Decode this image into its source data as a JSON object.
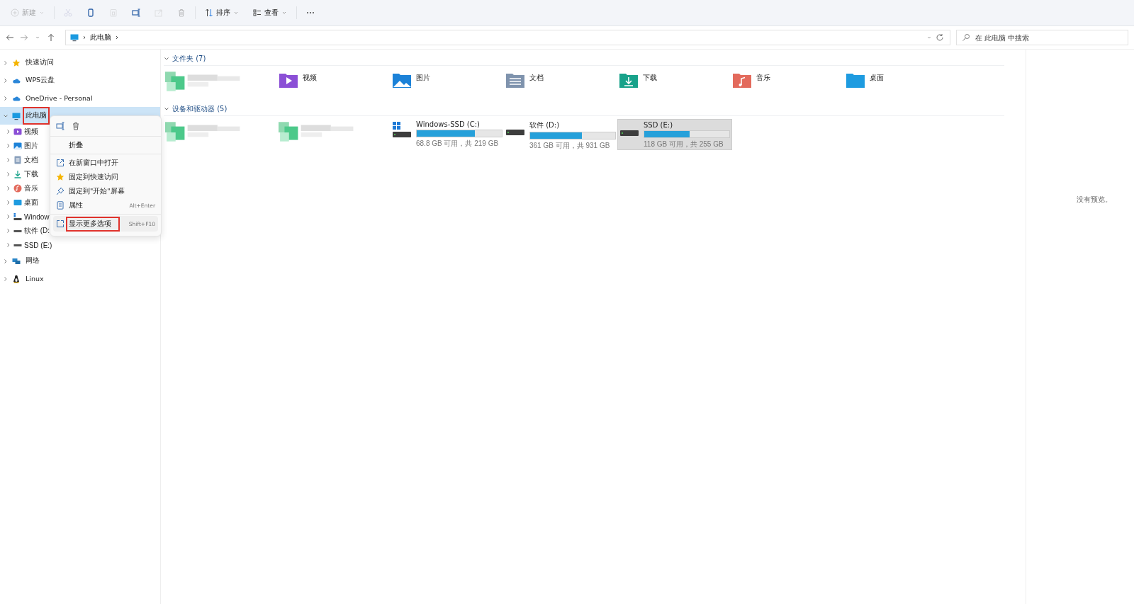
{
  "toolbar": {
    "items": [
      {
        "kind": "new",
        "label": "新建",
        "disabled": true
      },
      {
        "kind": "cut",
        "disabled": true
      },
      {
        "kind": "copy",
        "disabled": false
      },
      {
        "kind": "paste",
        "disabled": true
      },
      {
        "kind": "rename",
        "disabled": false
      },
      {
        "kind": "share",
        "disabled": true
      },
      {
        "kind": "delete",
        "disabled": true
      },
      {
        "kind": "sort",
        "label": "排序",
        "disabled": false
      },
      {
        "kind": "view",
        "label": "查看",
        "disabled": false
      },
      {
        "kind": "more",
        "disabled": false
      }
    ]
  },
  "address_bar": {
    "path": [
      "此电脑"
    ],
    "search": {
      "placeholder": "在 此电脑 中搜索"
    }
  },
  "sidebar": {
    "items": [
      {
        "kind": "star",
        "label": "快速访问",
        "expanded": false,
        "selected": false,
        "annotated": false
      },
      {
        "kind": "cloud",
        "label": "WPS云盘",
        "expanded": false,
        "selected": false,
        "annotated": false
      },
      {
        "kind": "cloud",
        "label": "OneDrive - Personal",
        "expanded": false,
        "selected": false,
        "annotated": false
      },
      {
        "kind": "pc",
        "label": "此电脑",
        "expanded": true,
        "selected": true,
        "annotated": true,
        "children": [
          {
            "kind": "video",
            "label": "视频"
          },
          {
            "kind": "pictures",
            "label": "图片"
          },
          {
            "kind": "docs",
            "label": "文档"
          },
          {
            "kind": "downloads",
            "label": "下载"
          },
          {
            "kind": "music",
            "label": "音乐"
          },
          {
            "kind": "desktop",
            "label": "桌面"
          },
          {
            "kind": "windrive",
            "label": "Window"
          },
          {
            "kind": "drive",
            "label": "软件 (D:"
          },
          {
            "kind": "drive",
            "label": "SSD (E:)"
          }
        ]
      },
      {
        "kind": "network",
        "label": "网络",
        "expanded": false,
        "selected": false,
        "annotated": false
      },
      {
        "kind": "linux",
        "label": "Linux",
        "expanded": false,
        "selected": false,
        "annotated": false
      }
    ]
  },
  "context_menu": {
    "actions": [
      {
        "kind": "rename"
      },
      {
        "kind": "delete"
      }
    ],
    "sections": [
      [
        {
          "kind": "none",
          "label": "折叠",
          "annotated": false
        }
      ],
      [
        {
          "kind": "open",
          "label": "在新窗口中打开",
          "annotated": false
        },
        {
          "kind": "star",
          "label": "固定到快速访问",
          "annotated": false
        },
        {
          "kind": "pin",
          "label": "固定到\"开始\"屏幕",
          "annotated": false
        },
        {
          "kind": "props",
          "label": "属性",
          "shortcut": "Alt+Enter",
          "annotated": false
        }
      ],
      [
        {
          "kind": "more",
          "label": "显示更多选项",
          "shortcut": "Shift+F10",
          "annotated": true
        }
      ]
    ]
  },
  "folders": {
    "title": "文件夹 (7)",
    "expanded": true,
    "items": [
      {
        "kind": "picture"
      },
      {
        "kind": "video",
        "label": "视频"
      },
      {
        "kind": "pictures",
        "label": "图片"
      },
      {
        "kind": "docs",
        "label": "文档"
      },
      {
        "kind": "downloads",
        "label": "下载"
      },
      {
        "kind": "music",
        "label": "音乐"
      },
      {
        "kind": "desktop",
        "label": "桌面"
      }
    ]
  },
  "devices": {
    "title": "设备和驱动器 (5)",
    "expanded": true,
    "items": [
      {
        "kind": "picture"
      },
      {
        "kind": "picture"
      },
      {
        "kind": "windrive",
        "name": "Windows-SSD (C:)",
        "level": 0.686,
        "reading": "68.8 GB 可用，共 219 GB",
        "selected": false
      },
      {
        "kind": "drive",
        "name": "软件 (D:)",
        "level": 0.612,
        "reading": "361 GB 可用，共 931 GB",
        "selected": false
      },
      {
        "kind": "drive",
        "name": "SSD (E:)",
        "level": 0.537,
        "reading": "118 GB 可用，共 255 GB",
        "selected": true
      }
    ]
  },
  "preview": {
    "message": "没有预览。"
  }
}
